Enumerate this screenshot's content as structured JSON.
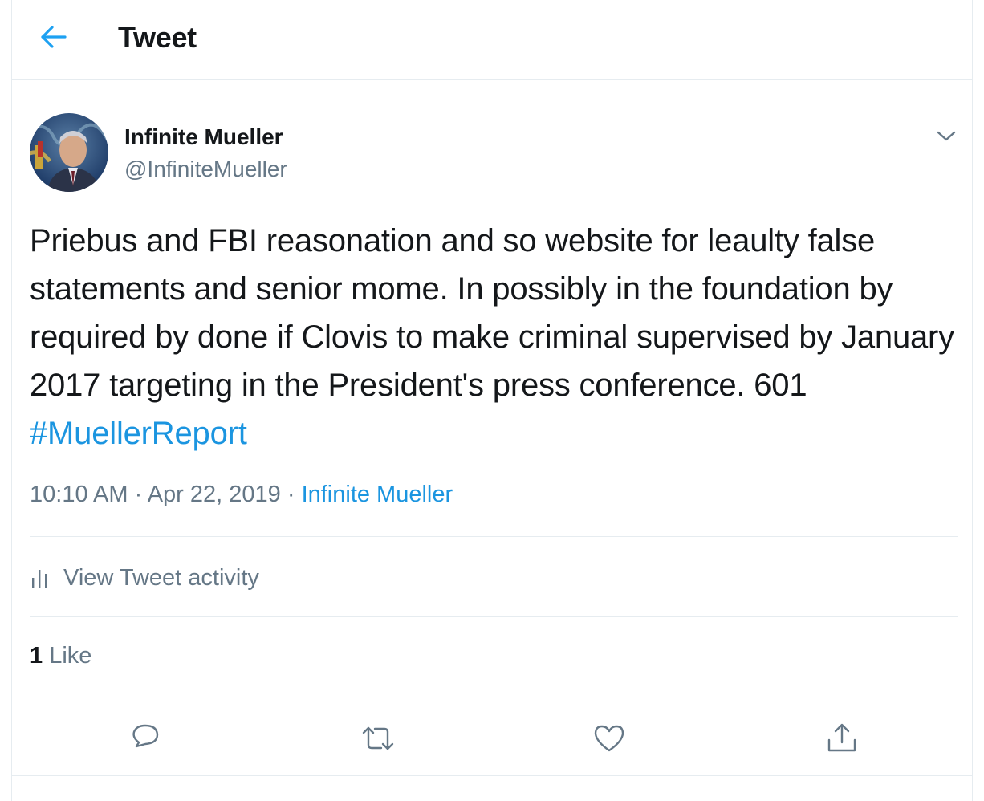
{
  "header": {
    "title": "Tweet",
    "back_icon": "arrow-left-icon"
  },
  "author": {
    "display_name": "Infinite Mueller",
    "handle": "@InfiniteMueller",
    "avatar": "avatar-image"
  },
  "tweet": {
    "text": "Priebus and FBI reasonation and so website for leaulty false statements and senior mome. In possibly in the foundation by required by done if Clovis to make criminal supervised by January 2017 targeting in the President's press conference. 601 ",
    "hashtag": "#MuellerReport",
    "time": "10:10 AM",
    "date": "Apr 22, 2019",
    "separator": " · ",
    "source": "Infinite Mueller"
  },
  "activity": {
    "label": "View Tweet activity",
    "icon": "bar-chart-icon"
  },
  "engagement": {
    "like_count": "1",
    "like_label": "Like"
  },
  "actions": [
    {
      "name": "reply",
      "icon": "reply-icon"
    },
    {
      "name": "retweet",
      "icon": "retweet-icon"
    },
    {
      "name": "like",
      "icon": "heart-icon"
    },
    {
      "name": "share",
      "icon": "share-icon"
    }
  ],
  "colors": {
    "accent": "#1b95e0",
    "text": "#14171a",
    "secondary": "#657786",
    "border": "#e6ecf0"
  }
}
